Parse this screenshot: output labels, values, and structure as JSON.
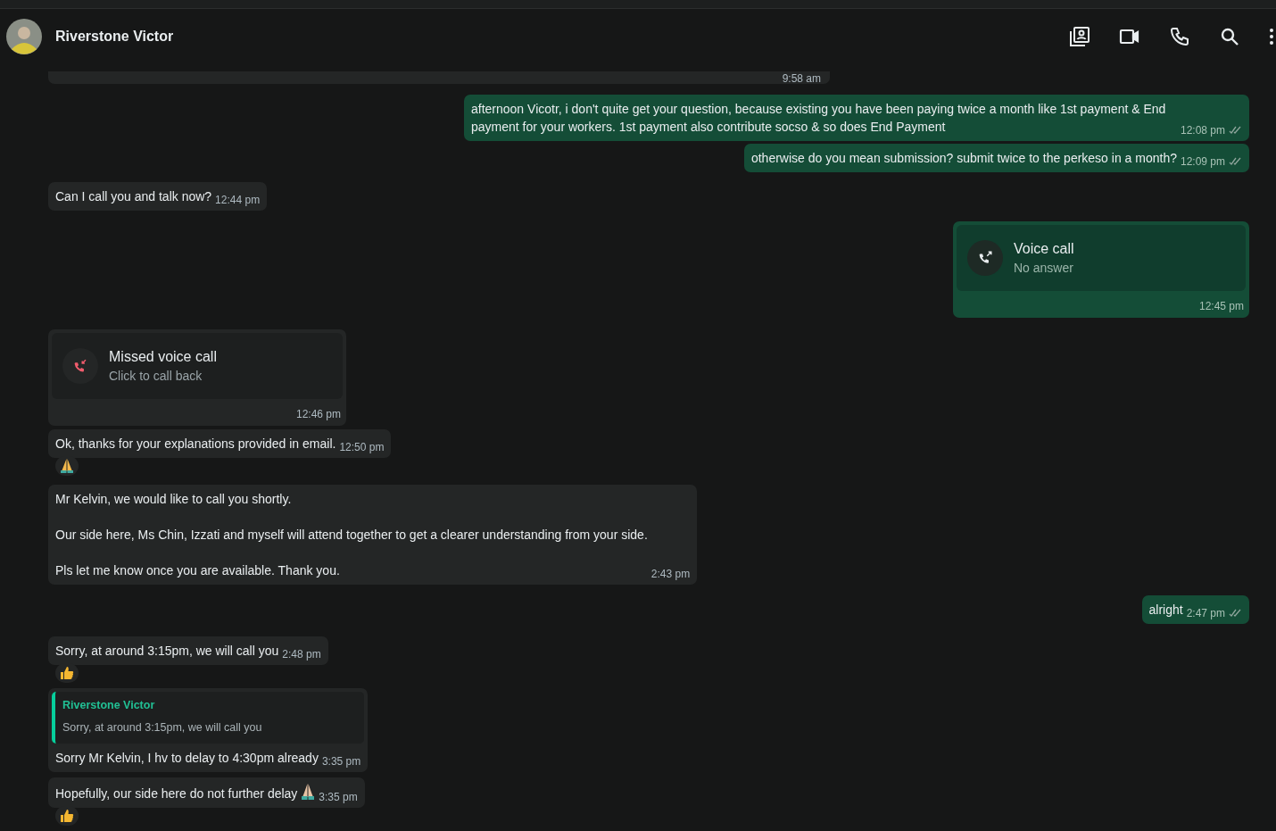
{
  "header": {
    "contact_name": "Riverstone Victor"
  },
  "messages": [
    {
      "outgoing": false,
      "kind": "partial",
      "time": "9:58 am"
    },
    {
      "outgoing": true,
      "kind": "text",
      "paragraphs": [
        "afternoon Vicotr, i don't quite get your question, because existing you have been paying twice a month like 1st payment & End payment for your workers. 1st payment also contribute socso & so does End Payment"
      ],
      "time": "12:08 pm",
      "read": false
    },
    {
      "outgoing": true,
      "kind": "text",
      "paragraphs": [
        "otherwise do you mean submission? submit twice to the perkeso in a month?"
      ],
      "time": "12:09 pm",
      "read": false
    },
    {
      "outgoing": false,
      "kind": "text",
      "paragraphs": [
        "Can I call you and talk now?"
      ],
      "time": "12:44 pm"
    },
    {
      "outgoing": true,
      "kind": "call",
      "missed": false,
      "title": "Voice call",
      "subtitle": "No answer",
      "time": "12:45 pm"
    },
    {
      "outgoing": false,
      "kind": "call",
      "missed": true,
      "title": "Missed voice call",
      "subtitle": "Click to call back",
      "time": "12:46 pm"
    },
    {
      "outgoing": false,
      "kind": "text",
      "paragraphs": [
        "Ok, thanks for your explanations provided in email."
      ],
      "time": "12:50 pm",
      "reaction": {
        "kind": "pray"
      }
    },
    {
      "outgoing": false,
      "kind": "text",
      "paragraphs": [
        "Mr Kelvin, we would like to call you shortly.",
        "Our side here, Ms Chin, Izzati and myself will attend together to get a clearer understanding from your side.",
        "Pls let me know once you are available. Thank you."
      ],
      "time": "2:43 pm"
    },
    {
      "outgoing": true,
      "kind": "text",
      "paragraphs": [
        "alright"
      ],
      "time": "2:47 pm",
      "read": false
    },
    {
      "outgoing": false,
      "kind": "text",
      "paragraphs": [
        "Sorry, at around 3:15pm, we will call you"
      ],
      "time": "2:48 pm",
      "reaction": {
        "kind": "thumbs_up"
      }
    },
    {
      "outgoing": false,
      "kind": "text",
      "quote": {
        "author": "Riverstone Victor",
        "text": "Sorry, at around 3:15pm, we will call you"
      },
      "paragraphs": [
        "Sorry Mr Kelvin, I hv to delay to 4:30pm already"
      ],
      "time": "3:35 pm"
    },
    {
      "outgoing": false,
      "kind": "text",
      "paragraphs": [
        "Hopefully, our side here do not further delay"
      ],
      "inline_emoji": {
        "kind": "pray"
      },
      "time": "3:35 pm",
      "reaction": {
        "kind": "thumbs_up"
      }
    }
  ]
}
